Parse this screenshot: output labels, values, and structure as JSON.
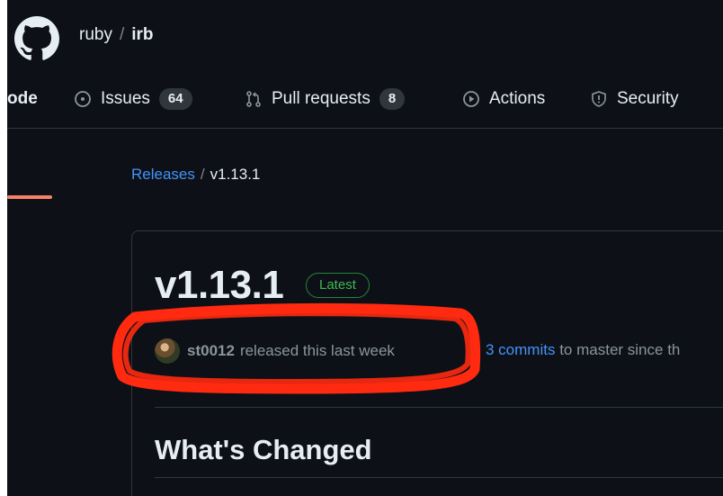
{
  "repo": {
    "owner": "ruby",
    "separator": "/",
    "name": "irb"
  },
  "tabs": [
    {
      "label": "ode",
      "icon": "code-icon",
      "active": true
    },
    {
      "label": "Issues",
      "count": "64",
      "icon": "issue-icon"
    },
    {
      "label": "Pull requests",
      "count": "8",
      "icon": "pull-request-icon"
    },
    {
      "label": "Actions",
      "icon": "play-icon"
    },
    {
      "label": "Security",
      "icon": "shield-icon"
    }
  ],
  "breadcrumb": {
    "parent": "Releases",
    "separator": "/",
    "current": "v1.13.1"
  },
  "release": {
    "version": "v1.13.1",
    "badge": "Latest",
    "author": "st0012",
    "released_text": "released this last week",
    "commits_link": "3 commits",
    "commits_text": "to master since th",
    "section_title": "What's Changed"
  },
  "colors": {
    "background": "#0d1117",
    "text": "#e6edf3",
    "muted": "#8b949e",
    "link": "#4493f8",
    "border": "#30363d",
    "badge_green": "#3fb950",
    "active_tab": "#f78166",
    "annotation": "#ff2a10"
  }
}
